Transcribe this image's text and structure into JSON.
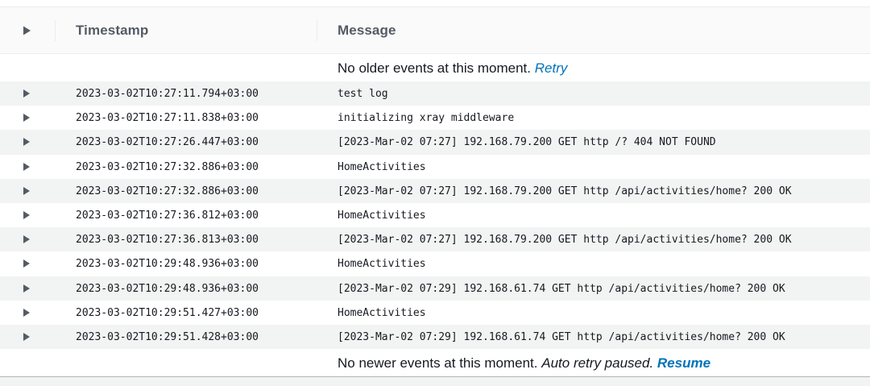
{
  "table": {
    "columns": {
      "timestamp": "Timestamp",
      "message": "Message"
    }
  },
  "top_banner": {
    "text": "No older events at this moment.",
    "link": "Retry"
  },
  "bottom_banner": {
    "text": "No newer events at this moment.",
    "italic": "Auto retry paused.",
    "link": "Resume"
  },
  "events": [
    {
      "timestamp": "2023-03-02T10:27:11.794+03:00",
      "message": "test log"
    },
    {
      "timestamp": "2023-03-02T10:27:11.838+03:00",
      "message": "initializing xray middleware"
    },
    {
      "timestamp": "2023-03-02T10:27:26.447+03:00",
      "message": "[2023-Mar-02 07:27] 192.168.79.200 GET http /? 404 NOT FOUND"
    },
    {
      "timestamp": "2023-03-02T10:27:32.886+03:00",
      "message": "HomeActivities"
    },
    {
      "timestamp": "2023-03-02T10:27:32.886+03:00",
      "message": "[2023-Mar-02 07:27] 192.168.79.200 GET http /api/activities/home? 200 OK"
    },
    {
      "timestamp": "2023-03-02T10:27:36.812+03:00",
      "message": "HomeActivities"
    },
    {
      "timestamp": "2023-03-02T10:27:36.813+03:00",
      "message": "[2023-Mar-02 07:27] 192.168.79.200 GET http /api/activities/home? 200 OK"
    },
    {
      "timestamp": "2023-03-02T10:29:48.936+03:00",
      "message": "HomeActivities"
    },
    {
      "timestamp": "2023-03-02T10:29:48.936+03:00",
      "message": "[2023-Mar-02 07:29] 192.168.61.74 GET http /api/activities/home? 200 OK"
    },
    {
      "timestamp": "2023-03-02T10:29:51.427+03:00",
      "message": "HomeActivities"
    },
    {
      "timestamp": "2023-03-02T10:29:51.428+03:00",
      "message": "[2023-Mar-02 07:29] 192.168.61.74 GET http /api/activities/home? 200 OK"
    }
  ],
  "colors": {
    "link": "#0073bb",
    "row_shade": "#f2f3f3",
    "header_bg": "#fafafa",
    "header_text": "#545b64",
    "caret": "#545b64"
  },
  "icons": {
    "expand_all": "caret-right-icon",
    "row_expand": "caret-right-icon"
  }
}
